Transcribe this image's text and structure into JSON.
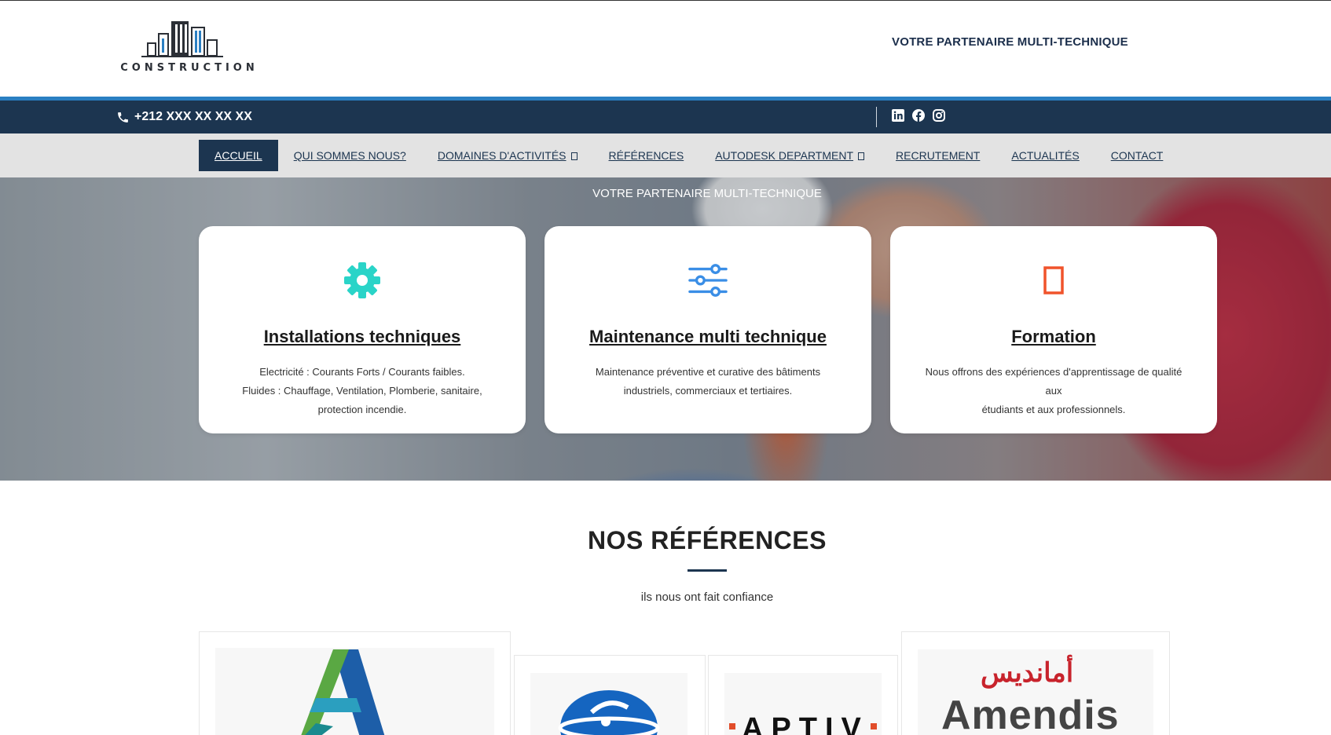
{
  "header": {
    "logo_text": "CONSTRUCTION",
    "tagline": "VOTRE PARTENAIRE MULTI-TECHNIQUE"
  },
  "topbar": {
    "phone": "+212 XXX XX XX XX",
    "socials": [
      "linkedin-icon",
      "facebook-icon",
      "instagram-icon"
    ]
  },
  "nav": {
    "items": [
      {
        "label": "ACCUEIL"
      },
      {
        "label": "QUI SOMMES NOUS?"
      },
      {
        "label": "DOMAINES D'ACTIVITÉS"
      },
      {
        "label": "RÉFÉRENCES"
      },
      {
        "label": "AUTODESK DEPARTMENT"
      },
      {
        "label": "RECRUTEMENT"
      },
      {
        "label": "ACTUALITÉS"
      },
      {
        "label": "CONTACT"
      }
    ]
  },
  "hero": {
    "caption": "VOTRE PARTENAIRE MULTI-TECHNIQUE",
    "cards": [
      {
        "title": "Installations techniques",
        "lines": [
          "Electricité : Courants Forts / Courants faibles.",
          "Fluides : Chauffage, Ventilation, Plomberie, sanitaire,",
          "protection incendie."
        ],
        "icon": "gear-icon",
        "color": "#2ad4c8"
      },
      {
        "title": "Maintenance multi technique",
        "lines": [
          "Maintenance préventive et curative des bâtiments",
          "industriels, commerciaux et tertiaires."
        ],
        "icon": "sliders-icon",
        "color": "#3a8ee6"
      },
      {
        "title": "Formation",
        "lines": [
          "Nous offrons des expériences d'apprentissage de qualité aux",
          "étudiants et aux professionnels."
        ],
        "icon": "tablet-icon",
        "color": "#f0532b"
      }
    ]
  },
  "references": {
    "title": "NOS RÉFÉRENCES",
    "subtitle": "ils nous ont fait confiance",
    "logos": {
      "aptiv": "APTIV",
      "amendis_arabic": "أمانديس",
      "amendis_latin": "Amendis"
    }
  }
}
